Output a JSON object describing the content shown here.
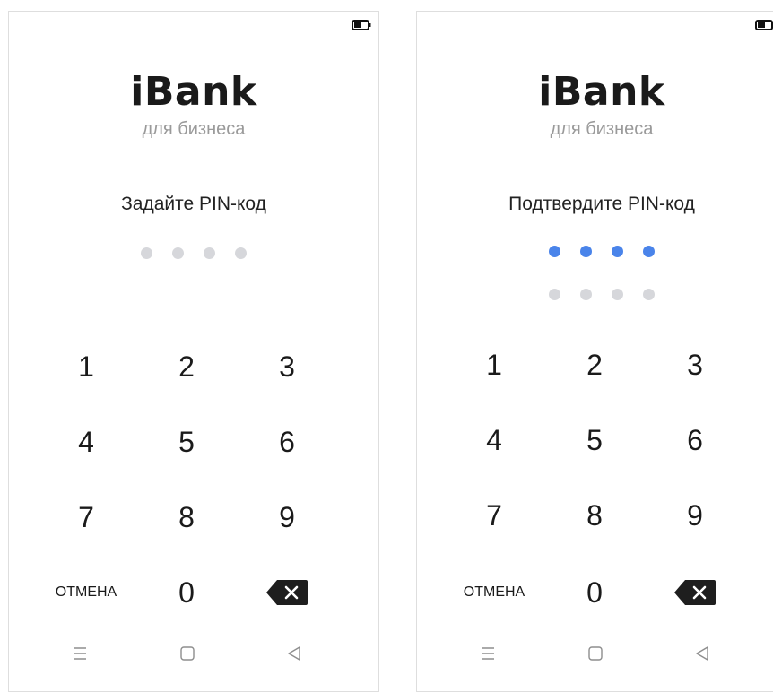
{
  "screens": [
    {
      "logo": "iBank",
      "tagline": "для бизнеса",
      "prompt": "Задайте PIN-код",
      "pin_rows": [
        [
          false,
          false,
          false,
          false
        ]
      ],
      "keys": [
        "1",
        "2",
        "3",
        "4",
        "5",
        "6",
        "7",
        "8",
        "9",
        "0"
      ],
      "cancel_label": "ОТМЕНА",
      "status_icon": "battery-icon",
      "nav_icons": [
        "menu-icon",
        "home-square-icon",
        "back-triangle-icon"
      ]
    },
    {
      "logo": "iBank",
      "tagline": "для бизнеса",
      "prompt": "Подтвердите PIN-код",
      "pin_rows": [
        [
          true,
          true,
          true,
          true
        ],
        [
          false,
          false,
          false,
          false
        ]
      ],
      "keys": [
        "1",
        "2",
        "3",
        "4",
        "5",
        "6",
        "7",
        "8",
        "9",
        "0"
      ],
      "cancel_label": "ОТМЕНА",
      "status_icon": "battery-icon",
      "nav_icons": [
        "menu-icon",
        "home-square-icon",
        "back-triangle-icon"
      ]
    }
  ],
  "colors": {
    "dot_filled": "#4a84ea",
    "dot_empty": "#d6d7db",
    "backspace_bg": "#1e1e1e"
  }
}
